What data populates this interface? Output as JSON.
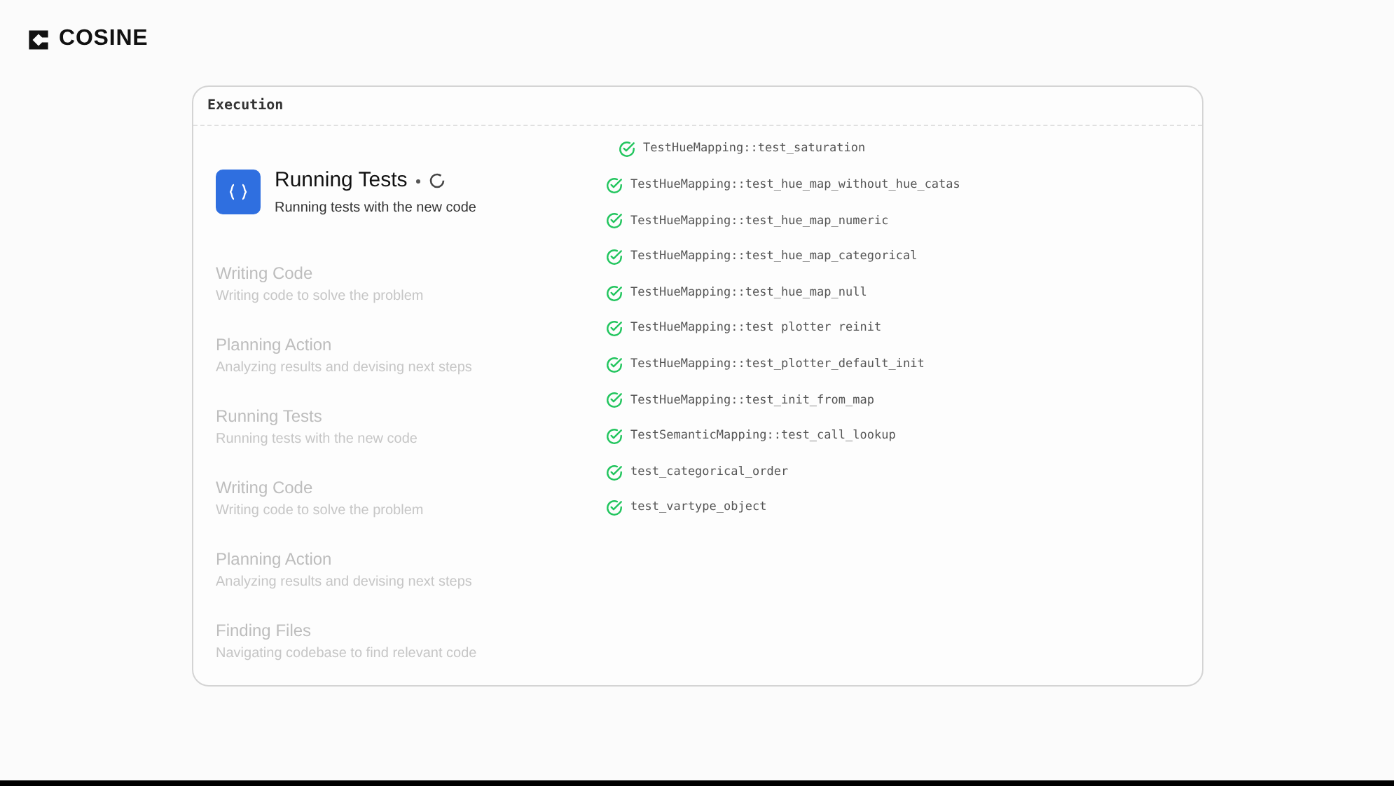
{
  "brand": {
    "name": "COSINE"
  },
  "panel": {
    "title": "Execution"
  },
  "steps": [
    {
      "title": "Running Tests",
      "subtitle": "Running tests with the new code",
      "active": true
    },
    {
      "title": "Writing Code",
      "subtitle": "Writing code to solve the problem",
      "active": false
    },
    {
      "title": "Planning Action",
      "subtitle": "Analyzing results and devising next steps",
      "active": false
    },
    {
      "title": "Running Tests",
      "subtitle": "Running tests with the new code",
      "active": false
    },
    {
      "title": "Writing Code",
      "subtitle": "Writing code to solve the problem",
      "active": false
    },
    {
      "title": "Planning Action",
      "subtitle": "Analyzing results and devising next steps",
      "active": false
    },
    {
      "title": "Finding Files",
      "subtitle": "Navigating codebase to find relevant code",
      "active": false
    }
  ],
  "tests": [
    {
      "name": "TestHueMapping::test_saturation",
      "passed": true
    },
    {
      "name": "TestHueMapping::test_hue_map_without_hue_catas",
      "passed": true
    },
    {
      "name": "TestHueMapping::test_hue_map_numeric",
      "passed": true
    },
    {
      "name": "TestHueMapping::test_hue_map_categorical",
      "passed": true
    },
    {
      "name": "TestHueMapping::test_hue_map_null",
      "passed": true
    },
    {
      "name": "TestHueMapping::test plotter reinit",
      "passed": true
    },
    {
      "name": "TestHueMapping::test_plotter_default_init",
      "passed": true
    },
    {
      "name": "TestHueMapping::test_init_from_map",
      "passed": true
    },
    {
      "name": "TestSemanticMapping::test_call_lookup",
      "passed": true
    },
    {
      "name": "test_categorical_order",
      "passed": true
    },
    {
      "name": "test_vartype_object",
      "passed": true
    }
  ]
}
